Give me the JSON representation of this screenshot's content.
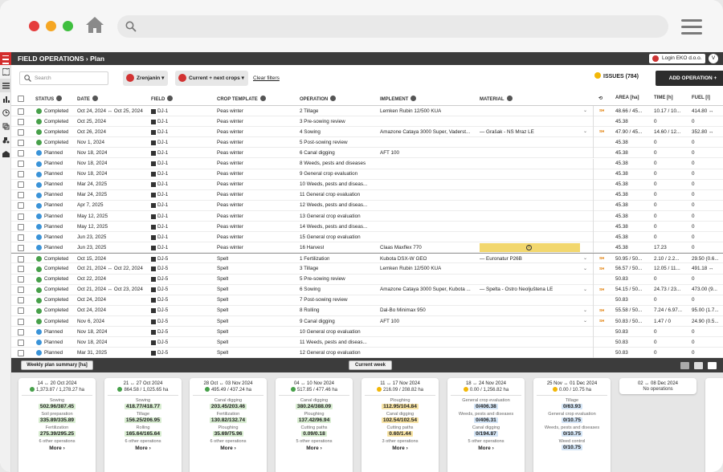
{
  "browser": {
    "dots": [
      "#e53d3d",
      "#f5a623",
      "#3fbf3f"
    ]
  },
  "app": {
    "section": "FIELD OPERATIONS",
    "page": "Plan",
    "login_label": "Login EKO d.o.o.",
    "avatar": "V"
  },
  "filters": {
    "search_placeholder": "Search",
    "region_chip": "Zrenjanin",
    "crop_chip": "Current + next crops",
    "clear": "Clear filters",
    "issues": "ISSUES (784)",
    "add": "ADD OPERATION +"
  },
  "columns": {
    "status": "STATUS",
    "date": "DATE",
    "field": "FIELD",
    "crop": "CROP TEMPLATE",
    "operation": "OPERATION",
    "implement": "IMPLEMENT",
    "material": "MATERIAL",
    "area": "AREA [ha]",
    "time": "TIME [h]",
    "fuel": "FUEL [l]"
  },
  "rows": [
    {
      "status": "Completed",
      "date": "Oct 24, 2024 ↔ Oct 25, 2024",
      "field": "DJ-1",
      "crop": "Peas winter",
      "op": "2  Tillage",
      "impl": "Lemken Rubin 12/500 KUA",
      "mat": "",
      "dd": "⌄",
      "sh": "SH",
      "area": "48.66 / 45...",
      "time": "10.17 / 10...",
      "fuel": "414.80 ↔"
    },
    {
      "status": "Completed",
      "date": "Oct 25, 2024",
      "field": "DJ-1",
      "crop": "Peas winter",
      "op": "3  Pre-sowing review",
      "impl": "",
      "mat": "",
      "dd": "",
      "sh": "",
      "area": "45.38",
      "time": "0",
      "fuel": "0"
    },
    {
      "status": "Completed",
      "date": "Oct 26, 2024",
      "field": "DJ-1",
      "crop": "Peas winter",
      "op": "4  Sowing",
      "impl": "Amazone Cataya 3000 Super, Vaderst...",
      "mat": "—  Grašak - NS Mraz LE",
      "dd": "⌄",
      "sh": "SH",
      "area": "47.90 / 45...",
      "time": "14.60 / 12...",
      "fuel": "352.80 ↔"
    },
    {
      "status": "Completed",
      "date": "Nov 1, 2024",
      "field": "DJ-1",
      "crop": "Peas winter",
      "op": "5  Post-sowing review",
      "impl": "",
      "mat": "",
      "dd": "",
      "sh": "",
      "area": "45.38",
      "time": "0",
      "fuel": "0"
    },
    {
      "status": "Planned",
      "date": "Nov 18, 2024",
      "field": "DJ-1",
      "crop": "Peas winter",
      "op": "6  Canal digging",
      "impl": "AFT 100",
      "mat": "",
      "dd": "",
      "sh": "",
      "area": "45.38",
      "time": "0",
      "fuel": "0"
    },
    {
      "status": "Planned",
      "date": "Nov 18, 2024",
      "field": "DJ-1",
      "crop": "Peas winter",
      "op": "8  Weeds, pests and diseases",
      "impl": "",
      "mat": "",
      "dd": "",
      "sh": "",
      "area": "45.38",
      "time": "0",
      "fuel": "0"
    },
    {
      "status": "Planned",
      "date": "Nov 18, 2024",
      "field": "DJ-1",
      "crop": "Peas winter",
      "op": "9  General crop evaluation",
      "impl": "",
      "mat": "",
      "dd": "",
      "sh": "",
      "area": "45.38",
      "time": "0",
      "fuel": "0"
    },
    {
      "status": "Planned",
      "date": "Mar 24, 2025",
      "field": "DJ-1",
      "crop": "Peas winter",
      "op": "10  Weeds, pests and diseas...",
      "impl": "",
      "mat": "",
      "dd": "",
      "sh": "",
      "area": "45.38",
      "time": "0",
      "fuel": "0"
    },
    {
      "status": "Planned",
      "date": "Mar 24, 2025",
      "field": "DJ-1",
      "crop": "Peas winter",
      "op": "11  General crop evaluation",
      "impl": "",
      "mat": "",
      "dd": "",
      "sh": "",
      "area": "45.38",
      "time": "0",
      "fuel": "0"
    },
    {
      "status": "Planned",
      "date": "Apr 7, 2025",
      "field": "DJ-1",
      "crop": "Peas winter",
      "op": "12  Weeds, pests and diseas...",
      "impl": "",
      "mat": "",
      "dd": "",
      "sh": "",
      "area": "45.38",
      "time": "0",
      "fuel": "0"
    },
    {
      "status": "Planned",
      "date": "May 12, 2025",
      "field": "DJ-1",
      "crop": "Peas winter",
      "op": "13  General crop evaluation",
      "impl": "",
      "mat": "",
      "dd": "",
      "sh": "",
      "area": "45.38",
      "time": "0",
      "fuel": "0"
    },
    {
      "status": "Planned",
      "date": "May 12, 2025",
      "field": "DJ-1",
      "crop": "Peas winter",
      "op": "14  Weeds, pests and diseas...",
      "impl": "",
      "mat": "",
      "dd": "",
      "sh": "",
      "area": "45.38",
      "time": "0",
      "fuel": "0"
    },
    {
      "status": "Planned",
      "date": "Jun 23, 2025",
      "field": "DJ-1",
      "crop": "Peas winter",
      "op": "15  General crop evaluation",
      "impl": "",
      "mat": "",
      "dd": "",
      "sh": "",
      "area": "45.38",
      "time": "0",
      "fuel": "0"
    },
    {
      "status": "Planned",
      "date": "Jun 23, 2025",
      "field": "DJ-1",
      "crop": "Peas winter",
      "op": "16  Harvest",
      "impl": "Claas Maxflex 770",
      "mat": "",
      "dd": "",
      "sh": "",
      "area": "45.38",
      "time": "17.23",
      "fuel": "0",
      "warn": true
    },
    {
      "status": "Completed",
      "date": "Oct 15, 2024",
      "field": "DJ-5",
      "crop": "Spelt",
      "op": "1  Fertilization",
      "impl": "Kubota DSX-W GEO",
      "mat": "—  Euronatur P26B",
      "dd": "⌄",
      "sh": "SH",
      "area": "50.95 / 50...",
      "time": "2.10 / 2.2...",
      "fuel": "29.50 (0.6...",
      "sep": true
    },
    {
      "status": "Completed",
      "date": "Oct 21, 2024 ↔ Oct 22, 2024",
      "field": "DJ-5",
      "crop": "Spelt",
      "op": "3  Tillage",
      "impl": "Lemken Rubin 12/500 KUA",
      "mat": "",
      "dd": "⌄",
      "sh": "SH",
      "area": "56.57 / 50...",
      "time": "12.05 / 11...",
      "fuel": "491.18 ↔"
    },
    {
      "status": "Completed",
      "date": "Oct 22, 2024",
      "field": "DJ-5",
      "crop": "Spelt",
      "op": "5  Pre-sowing review",
      "impl": "",
      "mat": "",
      "dd": "",
      "sh": "",
      "area": "50.83",
      "time": "0",
      "fuel": "0"
    },
    {
      "status": "Completed",
      "date": "Oct 21, 2024 ↔ Oct 23, 2024",
      "field": "DJ-5",
      "crop": "Spelt",
      "op": "6  Sowing",
      "impl": "Amazone Cataya 3000 Super, Kubota ...",
      "mat": "—  Spelta - Ostro Neoljuštena LE",
      "dd": "⌄",
      "sh": "SH",
      "area": "54.15 / 50...",
      "time": "24.73 / 23...",
      "fuel": "473.00 (9..."
    },
    {
      "status": "Completed",
      "date": "Oct 24, 2024",
      "field": "DJ-5",
      "crop": "Spelt",
      "op": "7  Post-sowing review",
      "impl": "",
      "mat": "",
      "dd": "",
      "sh": "",
      "area": "50.83",
      "time": "0",
      "fuel": "0"
    },
    {
      "status": "Completed",
      "date": "Oct 24, 2024",
      "field": "DJ-5",
      "crop": "Spelt",
      "op": "8  Rolling",
      "impl": "Dal-Bo Minimax 950",
      "mat": "",
      "dd": "⌄",
      "sh": "SH",
      "area": "55.58 / 50...",
      "time": "7.24 / 6.97...",
      "fuel": "95.00 (1.7..."
    },
    {
      "status": "Completed",
      "date": "Nov 6, 2024",
      "field": "DJ-5",
      "crop": "Spelt",
      "op": "9  Canal digging",
      "impl": "AFT 100",
      "mat": "",
      "dd": "⌄",
      "sh": "SH",
      "area": "50.83 / 50...",
      "time": "1.47 / 0",
      "fuel": "24.90 (0.5..."
    },
    {
      "status": "Planned",
      "date": "Nov 18, 2024",
      "field": "DJ-5",
      "crop": "Spelt",
      "op": "10  General crop evaluation",
      "impl": "",
      "mat": "",
      "dd": "",
      "sh": "",
      "area": "50.83",
      "time": "0",
      "fuel": "0"
    },
    {
      "status": "Planned",
      "date": "Nov 18, 2024",
      "field": "DJ-5",
      "crop": "Spelt",
      "op": "11  Weeds, pests and diseas...",
      "impl": "",
      "mat": "",
      "dd": "",
      "sh": "",
      "area": "50.83",
      "time": "0",
      "fuel": "0"
    },
    {
      "status": "Planned",
      "date": "Mar 31, 2025",
      "field": "DJ-5",
      "crop": "Spelt",
      "op": "12  General crop evaluation",
      "impl": "",
      "mat": "",
      "dd": "",
      "sh": "",
      "area": "50.83",
      "time": "0",
      "fuel": "0"
    }
  ],
  "summary": {
    "button": "Weekly plan summary [ha]",
    "current_week": "Current week",
    "more": "More ›"
  },
  "weeks": [
    {
      "range": "14 ↔ 20 Oct 2024",
      "total": "1,373.87 / 1,278.27 ha",
      "dot": "green",
      "ops": [
        [
          "Sowing",
          "502.96/387.45",
          "g"
        ],
        [
          "Soil preparation",
          "335.89/335.89",
          "g"
        ],
        [
          "Fertilization",
          "275.39/295.25",
          "g"
        ]
      ],
      "other": "6 other operations"
    },
    {
      "range": "21 ↔ 27 Oct 2024",
      "total": "864.58 / 1,025.65 ha",
      "dot": "green",
      "ops": [
        [
          "Sowing",
          "418.77/418.77",
          "g"
        ],
        [
          "Tillage",
          "156.25/206.95",
          "g"
        ],
        [
          "Rolling",
          "165.64/165.64",
          "g"
        ]
      ],
      "other": "6 other operations"
    },
    {
      "range": "28 Oct ↔ 03 Nov 2024",
      "total": "495.49 / 437.24 ha",
      "dot": "green",
      "ops": [
        [
          "Canal digging",
          "203.45/203.46",
          "g"
        ],
        [
          "Fertilization",
          "130.82/132.74",
          "g"
        ],
        [
          "Ploughing",
          "35.69/75.96",
          "g"
        ]
      ],
      "other": "6 other operations"
    },
    {
      "range": "04 ↔ 10 Nov 2024",
      "total": "517.85 / 477.46 ha",
      "dot": "green",
      "ops": [
        [
          "Canal digging",
          "380.24/388.09",
          "g"
        ],
        [
          "Ploughing",
          "137.42/96.94",
          "g"
        ],
        [
          "Cutting paths",
          "0.09/0.18",
          "g"
        ]
      ],
      "other": "5 other operations"
    },
    {
      "range": "11 ↔ 17 Nov 2024",
      "total": "216.09 / 208.82 ha",
      "dot": "yellow",
      "ops": [
        [
          "Ploughing",
          "112.95/104.84",
          "yl"
        ],
        [
          "Canal digging",
          "102.54/102.54",
          "yl"
        ],
        [
          "Cutting paths",
          "0.60/1.44",
          "yl"
        ]
      ],
      "other": "3 other operations"
    },
    {
      "range": "18 ↔ 24 Nov 2024",
      "total": "0.00 / 1,256.82 ha",
      "dot": "yellow",
      "ops": [
        [
          "General crop evaluation",
          "0/406.38",
          "b"
        ],
        [
          "Weeds, pests and diseases",
          "0/406.31",
          "b"
        ],
        [
          "Canal digging",
          "0/194.87",
          "b"
        ]
      ],
      "other": "5 other operations"
    },
    {
      "range": "25 Nov ↔ 01 Dec 2024",
      "total": "0.00 / 10.75 ha",
      "dot": "yellow",
      "ops": [
        [
          "Tillage",
          "0/63.93",
          "b"
        ],
        [
          "General crop evaluation",
          "0/10.75",
          "b"
        ],
        [
          "Weeds, pests and diseases",
          "0/10.75",
          "b"
        ],
        [
          "Weed control",
          "0/10.75",
          "b"
        ]
      ],
      "other": ""
    },
    {
      "range": "02 ↔ 08 Dec 2024",
      "total": "No operations",
      "dot": "",
      "ops": [],
      "other": ""
    }
  ]
}
